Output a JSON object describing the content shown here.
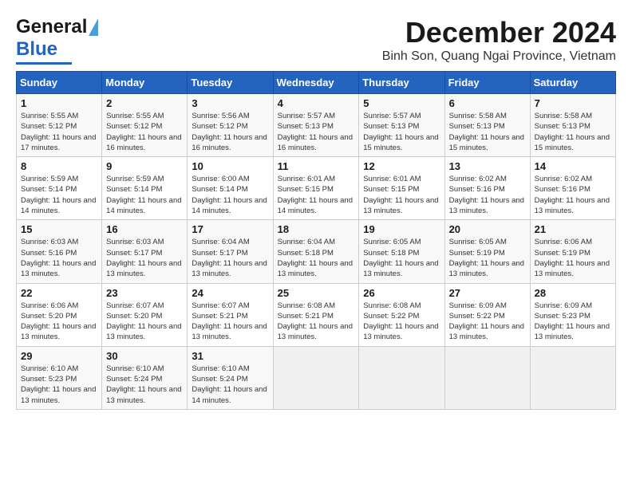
{
  "header": {
    "logo_general": "General",
    "logo_blue": "Blue",
    "month_title": "December 2024",
    "location": "Binh Son, Quang Ngai Province, Vietnam"
  },
  "weekdays": [
    "Sunday",
    "Monday",
    "Tuesday",
    "Wednesday",
    "Thursday",
    "Friday",
    "Saturday"
  ],
  "weeks": [
    [
      {
        "day": "1",
        "sunrise": "Sunrise: 5:55 AM",
        "sunset": "Sunset: 5:12 PM",
        "daylight": "Daylight: 11 hours and 17 minutes."
      },
      {
        "day": "2",
        "sunrise": "Sunrise: 5:55 AM",
        "sunset": "Sunset: 5:12 PM",
        "daylight": "Daylight: 11 hours and 16 minutes."
      },
      {
        "day": "3",
        "sunrise": "Sunrise: 5:56 AM",
        "sunset": "Sunset: 5:12 PM",
        "daylight": "Daylight: 11 hours and 16 minutes."
      },
      {
        "day": "4",
        "sunrise": "Sunrise: 5:57 AM",
        "sunset": "Sunset: 5:13 PM",
        "daylight": "Daylight: 11 hours and 16 minutes."
      },
      {
        "day": "5",
        "sunrise": "Sunrise: 5:57 AM",
        "sunset": "Sunset: 5:13 PM",
        "daylight": "Daylight: 11 hours and 15 minutes."
      },
      {
        "day": "6",
        "sunrise": "Sunrise: 5:58 AM",
        "sunset": "Sunset: 5:13 PM",
        "daylight": "Daylight: 11 hours and 15 minutes."
      },
      {
        "day": "7",
        "sunrise": "Sunrise: 5:58 AM",
        "sunset": "Sunset: 5:13 PM",
        "daylight": "Daylight: 11 hours and 15 minutes."
      }
    ],
    [
      {
        "day": "8",
        "sunrise": "Sunrise: 5:59 AM",
        "sunset": "Sunset: 5:14 PM",
        "daylight": "Daylight: 11 hours and 14 minutes."
      },
      {
        "day": "9",
        "sunrise": "Sunrise: 5:59 AM",
        "sunset": "Sunset: 5:14 PM",
        "daylight": "Daylight: 11 hours and 14 minutes."
      },
      {
        "day": "10",
        "sunrise": "Sunrise: 6:00 AM",
        "sunset": "Sunset: 5:14 PM",
        "daylight": "Daylight: 11 hours and 14 minutes."
      },
      {
        "day": "11",
        "sunrise": "Sunrise: 6:01 AM",
        "sunset": "Sunset: 5:15 PM",
        "daylight": "Daylight: 11 hours and 14 minutes."
      },
      {
        "day": "12",
        "sunrise": "Sunrise: 6:01 AM",
        "sunset": "Sunset: 5:15 PM",
        "daylight": "Daylight: 11 hours and 13 minutes."
      },
      {
        "day": "13",
        "sunrise": "Sunrise: 6:02 AM",
        "sunset": "Sunset: 5:16 PM",
        "daylight": "Daylight: 11 hours and 13 minutes."
      },
      {
        "day": "14",
        "sunrise": "Sunrise: 6:02 AM",
        "sunset": "Sunset: 5:16 PM",
        "daylight": "Daylight: 11 hours and 13 minutes."
      }
    ],
    [
      {
        "day": "15",
        "sunrise": "Sunrise: 6:03 AM",
        "sunset": "Sunset: 5:16 PM",
        "daylight": "Daylight: 11 hours and 13 minutes."
      },
      {
        "day": "16",
        "sunrise": "Sunrise: 6:03 AM",
        "sunset": "Sunset: 5:17 PM",
        "daylight": "Daylight: 11 hours and 13 minutes."
      },
      {
        "day": "17",
        "sunrise": "Sunrise: 6:04 AM",
        "sunset": "Sunset: 5:17 PM",
        "daylight": "Daylight: 11 hours and 13 minutes."
      },
      {
        "day": "18",
        "sunrise": "Sunrise: 6:04 AM",
        "sunset": "Sunset: 5:18 PM",
        "daylight": "Daylight: 11 hours and 13 minutes."
      },
      {
        "day": "19",
        "sunrise": "Sunrise: 6:05 AM",
        "sunset": "Sunset: 5:18 PM",
        "daylight": "Daylight: 11 hours and 13 minutes."
      },
      {
        "day": "20",
        "sunrise": "Sunrise: 6:05 AM",
        "sunset": "Sunset: 5:19 PM",
        "daylight": "Daylight: 11 hours and 13 minutes."
      },
      {
        "day": "21",
        "sunrise": "Sunrise: 6:06 AM",
        "sunset": "Sunset: 5:19 PM",
        "daylight": "Daylight: 11 hours and 13 minutes."
      }
    ],
    [
      {
        "day": "22",
        "sunrise": "Sunrise: 6:06 AM",
        "sunset": "Sunset: 5:20 PM",
        "daylight": "Daylight: 11 hours and 13 minutes."
      },
      {
        "day": "23",
        "sunrise": "Sunrise: 6:07 AM",
        "sunset": "Sunset: 5:20 PM",
        "daylight": "Daylight: 11 hours and 13 minutes."
      },
      {
        "day": "24",
        "sunrise": "Sunrise: 6:07 AM",
        "sunset": "Sunset: 5:21 PM",
        "daylight": "Daylight: 11 hours and 13 minutes."
      },
      {
        "day": "25",
        "sunrise": "Sunrise: 6:08 AM",
        "sunset": "Sunset: 5:21 PM",
        "daylight": "Daylight: 11 hours and 13 minutes."
      },
      {
        "day": "26",
        "sunrise": "Sunrise: 6:08 AM",
        "sunset": "Sunset: 5:22 PM",
        "daylight": "Daylight: 11 hours and 13 minutes."
      },
      {
        "day": "27",
        "sunrise": "Sunrise: 6:09 AM",
        "sunset": "Sunset: 5:22 PM",
        "daylight": "Daylight: 11 hours and 13 minutes."
      },
      {
        "day": "28",
        "sunrise": "Sunrise: 6:09 AM",
        "sunset": "Sunset: 5:23 PM",
        "daylight": "Daylight: 11 hours and 13 minutes."
      }
    ],
    [
      {
        "day": "29",
        "sunrise": "Sunrise: 6:10 AM",
        "sunset": "Sunset: 5:23 PM",
        "daylight": "Daylight: 11 hours and 13 minutes."
      },
      {
        "day": "30",
        "sunrise": "Sunrise: 6:10 AM",
        "sunset": "Sunset: 5:24 PM",
        "daylight": "Daylight: 11 hours and 13 minutes."
      },
      {
        "day": "31",
        "sunrise": "Sunrise: 6:10 AM",
        "sunset": "Sunset: 5:24 PM",
        "daylight": "Daylight: 11 hours and 14 minutes."
      },
      null,
      null,
      null,
      null
    ]
  ]
}
